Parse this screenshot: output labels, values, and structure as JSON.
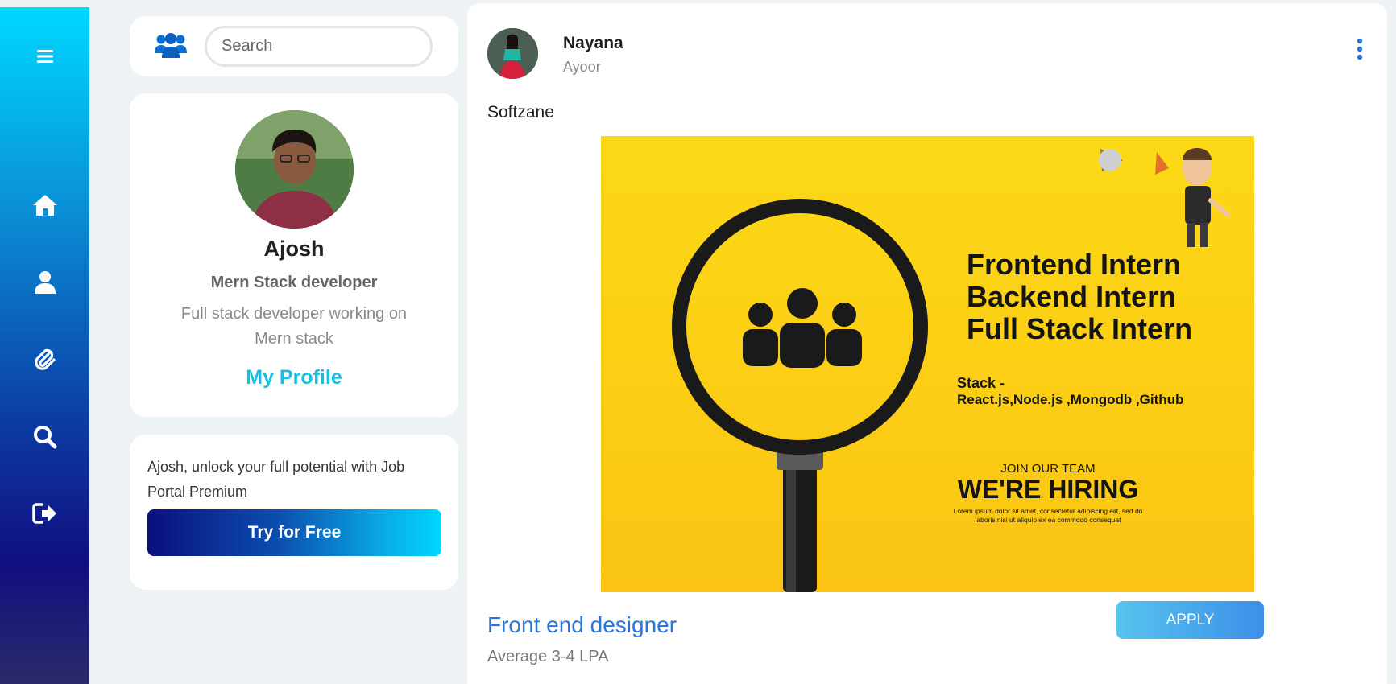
{
  "nav": {
    "items": [
      {
        "icon": "menu-icon"
      },
      {
        "icon": "home-icon"
      },
      {
        "icon": "user-icon"
      },
      {
        "icon": "paperclip-icon"
      },
      {
        "icon": "search-icon"
      },
      {
        "icon": "logout-icon"
      }
    ]
  },
  "search": {
    "icon": "users-icon",
    "placeholder": "Search",
    "value": ""
  },
  "profile": {
    "name": "Ajosh",
    "role": "Mern Stack developer",
    "bio": "Full stack developer working on Mern stack",
    "link_label": "My Profile"
  },
  "premium": {
    "text": "Ajosh, unlock your full potential with Job Portal Premium",
    "button_label": "Try for Free"
  },
  "post": {
    "author": "Nayana",
    "company": "Ayoor",
    "text": "Softzane",
    "poster": {
      "roles": [
        "Frontend Intern",
        "Backend Intern",
        "Full Stack Intern"
      ],
      "stack_heading": "Stack -",
      "stack": "React.js,Node.js ,Mongodb ,Github",
      "join": "JOIN OUR TEAM",
      "hiring": "WE'RE HIRING",
      "lorem1": "Lorem ipsum dolor sit amet, consectetur adipiscing elit, sed do",
      "lorem2": "laboris nisi ut aliquip ex ea commodo consequat"
    },
    "job_title": "Front end designer",
    "salary": "Average 3-4 LPA",
    "apply_label": "APPLY"
  },
  "colors": {
    "accent": "#17bfe3",
    "link_blue": "#2a74d8",
    "poster_yellow": "#fbd314"
  }
}
